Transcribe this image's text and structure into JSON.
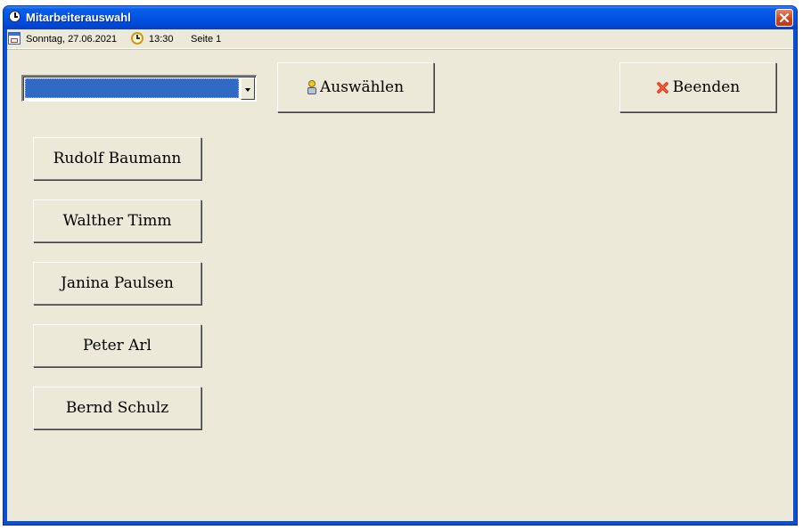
{
  "window": {
    "title": "Mitarbeiterauswahl"
  },
  "status": {
    "date": "Sonntag, 27.06.2021",
    "time": "13:30",
    "page": "Seite 1"
  },
  "combo": {
    "selected": ""
  },
  "buttons": {
    "select": "Auswählen",
    "quit": "Beenden"
  },
  "employees": [
    "Rudolf Baumann",
    "Walther Timm",
    "Janina Paulsen",
    "Peter Arl",
    "Bernd Schulz"
  ],
  "icons": {
    "window": "clock-icon",
    "date": "calendar-icon",
    "time": "clock-icon",
    "select": "user-icon",
    "quit": "red-x-icon",
    "close": "close-icon"
  },
  "colors": {
    "titlebar": "#0054e3",
    "client": "#ece9d8",
    "selection": "#316ac5",
    "close_red": "#d8431c"
  }
}
